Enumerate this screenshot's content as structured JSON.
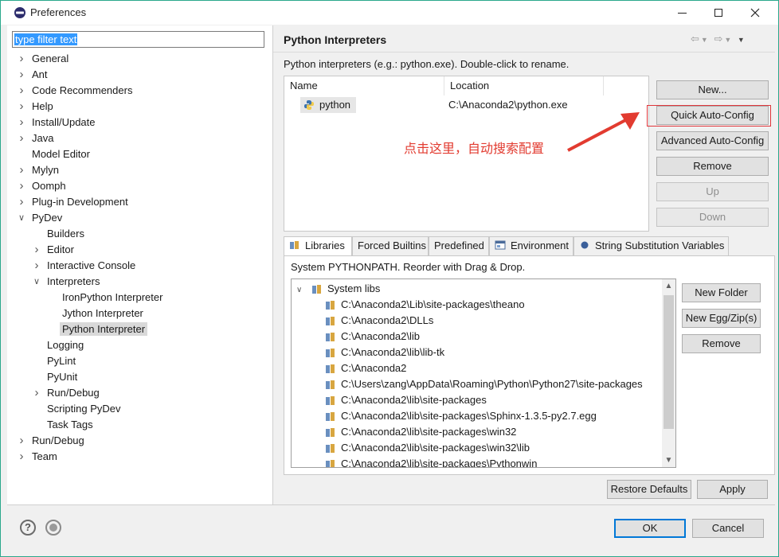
{
  "window": {
    "title": "Preferences"
  },
  "filter": {
    "value": "type filter text"
  },
  "tree": [
    {
      "label": "General",
      "level": 0,
      "expander": "right"
    },
    {
      "label": "Ant",
      "level": 0,
      "expander": "right"
    },
    {
      "label": "Code Recommenders",
      "level": 0,
      "expander": "right"
    },
    {
      "label": "Help",
      "level": 0,
      "expander": "right"
    },
    {
      "label": "Install/Update",
      "level": 0,
      "expander": "right"
    },
    {
      "label": "Java",
      "level": 0,
      "expander": "right"
    },
    {
      "label": "Model Editor",
      "level": 0,
      "expander": "none"
    },
    {
      "label": "Mylyn",
      "level": 0,
      "expander": "right"
    },
    {
      "label": "Oomph",
      "level": 0,
      "expander": "right"
    },
    {
      "label": "Plug-in Development",
      "level": 0,
      "expander": "right"
    },
    {
      "label": "PyDev",
      "level": 0,
      "expander": "down"
    },
    {
      "label": "Builders",
      "level": 1,
      "expander": "none"
    },
    {
      "label": "Editor",
      "level": 1,
      "expander": "right"
    },
    {
      "label": "Interactive Console",
      "level": 1,
      "expander": "right"
    },
    {
      "label": "Interpreters",
      "level": 1,
      "expander": "down"
    },
    {
      "label": "IronPython Interpreter",
      "level": 2,
      "expander": "none"
    },
    {
      "label": "Jython Interpreter",
      "level": 2,
      "expander": "none"
    },
    {
      "label": "Python Interpreter",
      "level": 2,
      "expander": "none",
      "selected": true
    },
    {
      "label": "Logging",
      "level": 1,
      "expander": "none"
    },
    {
      "label": "PyLint",
      "level": 1,
      "expander": "none"
    },
    {
      "label": "PyUnit",
      "level": 1,
      "expander": "none"
    },
    {
      "label": "Run/Debug",
      "level": 1,
      "expander": "right"
    },
    {
      "label": "Scripting PyDev",
      "level": 1,
      "expander": "none"
    },
    {
      "label": "Task Tags",
      "level": 1,
      "expander": "none"
    },
    {
      "label": "Run/Debug",
      "level": 0,
      "expander": "right"
    },
    {
      "label": "Team",
      "level": 0,
      "expander": "right"
    }
  ],
  "page": {
    "title": "Python Interpreters",
    "description": "Python interpreters (e.g.: python.exe).   Double-click to rename."
  },
  "interpreters": {
    "columns": [
      "Name",
      "Location"
    ],
    "rows": [
      {
        "name": "python",
        "location": "C:\\Anaconda2\\python.exe"
      }
    ]
  },
  "buttons": {
    "new": "New...",
    "quick_auto_config": "Quick Auto-Config",
    "advanced_auto_config": "Advanced Auto-Config",
    "remove": "Remove",
    "up": "Up",
    "down": "Down",
    "new_folder": "New Folder",
    "new_egg": "New Egg/Zip(s)",
    "remove_lib": "Remove",
    "restore_defaults": "Restore Defaults",
    "apply": "Apply",
    "ok": "OK",
    "cancel": "Cancel"
  },
  "annotation": {
    "text": "点击这里，自动搜索配置",
    "color": "#e23b30"
  },
  "tabs": [
    "Libraries",
    "Forced Builtins",
    "Predefined",
    "Environment",
    "String Substitution Variables"
  ],
  "libraries": {
    "description": "System PYTHONPATH.   Reorder with Drag & Drop.",
    "root": "System libs",
    "items": [
      "C:\\Anaconda2\\Lib\\site-packages\\theano",
      "C:\\Anaconda2\\DLLs",
      "C:\\Anaconda2\\lib",
      "C:\\Anaconda2\\lib\\lib-tk",
      "C:\\Anaconda2",
      "C:\\Users\\zang\\AppData\\Roaming\\Python\\Python27\\site-packages",
      "C:\\Anaconda2\\lib\\site-packages",
      "C:\\Anaconda2\\lib\\site-packages\\Sphinx-1.3.5-py2.7.egg",
      "C:\\Anaconda2\\lib\\site-packages\\win32",
      "C:\\Anaconda2\\lib\\site-packages\\win32\\lib",
      "C:\\Anaconda2\\lib\\site-packages\\Pythonwin"
    ]
  },
  "colors": {
    "accent": "#0078d7",
    "highlight_border": "#e0353a",
    "window_border": "#2aa88c"
  }
}
